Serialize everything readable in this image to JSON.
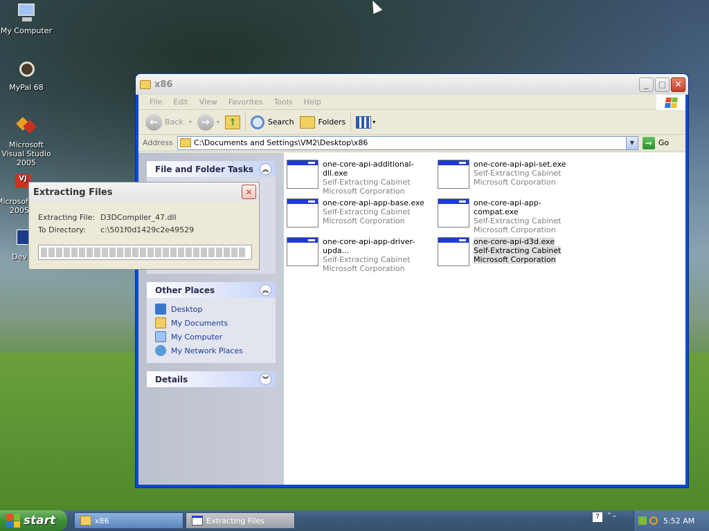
{
  "desktop": {
    "icons": [
      {
        "label": "My Computer"
      },
      {
        "label": "MyPal 68"
      },
      {
        "label": "Microsoft Visual Studio 2005"
      },
      {
        "label": "Microsoft J# 2005"
      },
      {
        "label": "Dev-"
      }
    ]
  },
  "window": {
    "title": "x86",
    "menu": [
      "File",
      "Edit",
      "View",
      "Favorites",
      "Tools",
      "Help"
    ],
    "toolbar": {
      "back": "Back",
      "search": "Search",
      "folders": "Folders"
    },
    "address": {
      "label": "Address",
      "value": "C:\\Documents and Settings\\VM2\\Desktop\\x86",
      "go": "Go"
    },
    "taskpane": {
      "file_tasks_title": "File and Folder Tasks",
      "other_places_title": "Other Places",
      "other_places": [
        "Desktop",
        "My Documents",
        "My Computer",
        "My Network Places"
      ],
      "details_title": "Details"
    },
    "files": [
      {
        "name": "one-core-api-additional-dll.exe",
        "type": "Self-Extracting Cabinet",
        "company": "Microsoft Corporation"
      },
      {
        "name": "one-core-api-api-set.exe",
        "type": "Self-Extracting Cabinet",
        "company": "Microsoft Corporation"
      },
      {
        "name": "one-core-api-app-base.exe",
        "type": "Self-Extracting Cabinet",
        "company": "Microsoft Corporation"
      },
      {
        "name": "one-core-api-app-compat.exe",
        "type": "Self-Extracting Cabinet",
        "company": "Microsoft Corporation"
      },
      {
        "name": "one-core-api-app-driver-upda...",
        "type": "Self-Extracting Cabinet",
        "company": "Microsoft Corporation"
      },
      {
        "name": "one-core-api-d3d.exe",
        "type": "Self-Extracting Cabinet",
        "company": "Microsoft Corporation"
      }
    ]
  },
  "dialog": {
    "title": "Extracting Files",
    "file_label": "Extracting File:",
    "file_value": "D3DCompiler_47.dll",
    "dir_label": "To Directory:",
    "dir_value": "c:\\501f0d1429c2e49529"
  },
  "taskbar": {
    "start": "start",
    "tasks": [
      "x86",
      "Extracting Files"
    ],
    "clock": "5:52 AM"
  },
  "colors": {
    "accent": "#0a49d0",
    "taskpane": "#7a8ed6",
    "start_green": "#3e8f35"
  }
}
